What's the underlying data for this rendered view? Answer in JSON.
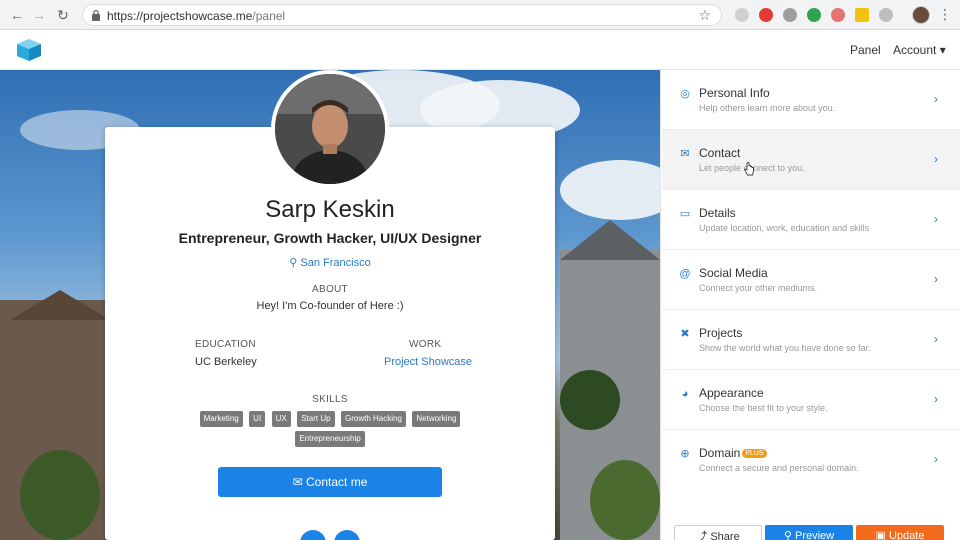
{
  "browser": {
    "url_host": "https://projectshowcase.me",
    "url_path": "/panel",
    "colors": {
      "chrome_bg": "#f1f3f4"
    }
  },
  "appbar": {
    "panel_label": "Panel",
    "account_label": "Account",
    "account_caret": "▾"
  },
  "profile": {
    "name": "Sarp Keskin",
    "headline": "Entrepreneur, Growth Hacker, UI/UX Designer",
    "location": "San Francisco",
    "about_label": "ABOUT",
    "about_text": "Hey! I'm Co-founder of Here :)",
    "education_label": "EDUCATION",
    "education_value": "UC Berkeley",
    "work_label": "WORK",
    "work_value": "Project Showcase",
    "skills_label": "SKILLS",
    "skills": [
      "Marketing",
      "UI",
      "UX",
      "Start Up",
      "Growth Hacking",
      "Networking",
      "Entrepreneurship"
    ],
    "contact_button": "Contact me"
  },
  "panel": {
    "items": [
      {
        "title": "Personal Info",
        "subtitle": "Help others learn more about you.",
        "icon": "user-circle-icon",
        "glyph": "◎"
      },
      {
        "title": "Contact",
        "subtitle": "Let people connect to you.",
        "icon": "envelope-icon",
        "glyph": "✉"
      },
      {
        "title": "Details",
        "subtitle": "Update location, work, education and skills",
        "icon": "id-card-icon",
        "glyph": "▭"
      },
      {
        "title": "Social Media",
        "subtitle": "Connect your other mediums.",
        "icon": "at-icon",
        "glyph": "@"
      },
      {
        "title": "Projects",
        "subtitle": "Show the world what you have done so far.",
        "icon": "tools-icon",
        "glyph": "✖"
      },
      {
        "title": "Appearance",
        "subtitle": "Choose the best fit to your style.",
        "icon": "palette-icon",
        "glyph": "◕"
      },
      {
        "title": "Domain",
        "subtitle": "Connect a secure and personal domain.",
        "icon": "globe-icon",
        "glyph": "⊕",
        "badge": "PLUS"
      }
    ],
    "chevron": "›",
    "buttons": {
      "share": "Share",
      "preview": "Preview",
      "update": "Update"
    },
    "colors": {
      "accent": "#2a7ac9",
      "preview": "#1c83e6",
      "update": "#f26b1d",
      "badge": "#f39c12"
    }
  }
}
